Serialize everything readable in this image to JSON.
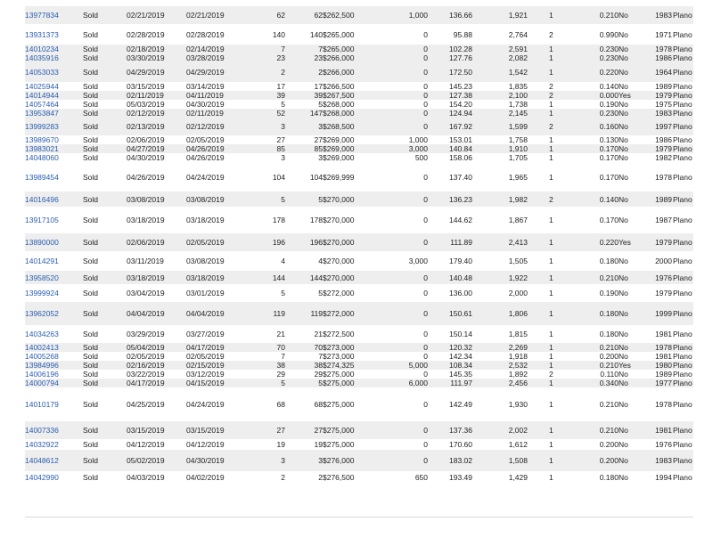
{
  "listings": [
    {
      "mls": "13977834",
      "status": "Sold",
      "sold_date": "02/21/2019",
      "list_date": "02/21/2019",
      "dom": "62",
      "cdom": "62",
      "price": "$262,500",
      "concessions": "1,000",
      "price_per_sqft": "136.66",
      "sqft": "1,921",
      "beds": "1",
      "acres": "0.210",
      "pool": "No",
      "year_built": "1983",
      "city": "Plano"
    },
    {
      "mls": "13931373",
      "status": "Sold",
      "sold_date": "02/28/2019",
      "list_date": "02/28/2019",
      "dom": "140",
      "cdom": "140",
      "price": "$265,000",
      "concessions": "0",
      "price_per_sqft": "95.88",
      "sqft": "2,764",
      "beds": "2",
      "acres": "0.990",
      "pool": "No",
      "year_built": "1971",
      "city": "Plano"
    },
    {
      "mls": "14010234",
      "status": "Sold",
      "sold_date": "02/18/2019",
      "list_date": "02/14/2019",
      "dom": "7",
      "cdom": "7",
      "price": "$265,000",
      "concessions": "0",
      "price_per_sqft": "102.28",
      "sqft": "2,591",
      "beds": "1",
      "acres": "0.230",
      "pool": "No",
      "year_built": "1978",
      "city": "Plano"
    },
    {
      "mls": "14035916",
      "status": "Sold",
      "sold_date": "03/30/2019",
      "list_date": "03/28/2019",
      "dom": "23",
      "cdom": "23",
      "price": "$266,000",
      "concessions": "0",
      "price_per_sqft": "127.76",
      "sqft": "2,082",
      "beds": "1",
      "acres": "0.230",
      "pool": "No",
      "year_built": "1986",
      "city": "Plano"
    },
    {
      "mls": "14053033",
      "status": "Sold",
      "sold_date": "04/29/2019",
      "list_date": "04/29/2019",
      "dom": "2",
      "cdom": "2",
      "price": "$266,000",
      "concessions": "0",
      "price_per_sqft": "172.50",
      "sqft": "1,542",
      "beds": "1",
      "acres": "0.220",
      "pool": "No",
      "year_built": "1964",
      "city": "Plano"
    },
    {
      "mls": "14025944",
      "status": "Sold",
      "sold_date": "03/15/2019",
      "list_date": "03/14/2019",
      "dom": "17",
      "cdom": "17",
      "price": "$266,500",
      "concessions": "0",
      "price_per_sqft": "145.23",
      "sqft": "1,835",
      "beds": "2",
      "acres": "0.140",
      "pool": "No",
      "year_built": "1989",
      "city": "Plano"
    },
    {
      "mls": "14014944",
      "status": "Sold",
      "sold_date": "02/11/2019",
      "list_date": "04/11/2019",
      "dom": "39",
      "cdom": "39",
      "price": "$267,500",
      "concessions": "0",
      "price_per_sqft": "127.38",
      "sqft": "2,100",
      "beds": "2",
      "acres": "0.000",
      "pool": "Yes",
      "year_built": "1979",
      "city": "Plano"
    },
    {
      "mls": "14057464",
      "status": "Sold",
      "sold_date": "05/03/2019",
      "list_date": "04/30/2019",
      "dom": "5",
      "cdom": "5",
      "price": "$268,000",
      "concessions": "0",
      "price_per_sqft": "154.20",
      "sqft": "1,738",
      "beds": "1",
      "acres": "0.190",
      "pool": "No",
      "year_built": "1975",
      "city": "Plano"
    },
    {
      "mls": "13953847",
      "status": "Sold",
      "sold_date": "02/12/2019",
      "list_date": "02/11/2019",
      "dom": "52",
      "cdom": "147",
      "price": "$268,000",
      "concessions": "0",
      "price_per_sqft": "124.94",
      "sqft": "2,145",
      "beds": "1",
      "acres": "0.230",
      "pool": "No",
      "year_built": "1983",
      "city": "Plano"
    },
    {
      "mls": "13999283",
      "status": "Sold",
      "sold_date": "02/13/2019",
      "list_date": "02/12/2019",
      "dom": "3",
      "cdom": "3",
      "price": "$268,500",
      "concessions": "0",
      "price_per_sqft": "167.92",
      "sqft": "1,599",
      "beds": "2",
      "acres": "0.160",
      "pool": "No",
      "year_built": "1997",
      "city": "Plano"
    },
    {
      "mls": "13989670",
      "status": "Sold",
      "sold_date": "02/06/2019",
      "list_date": "02/05/2019",
      "dom": "27",
      "cdom": "27",
      "price": "$269,000",
      "concessions": "1,000",
      "price_per_sqft": "153.01",
      "sqft": "1,758",
      "beds": "1",
      "acres": "0.130",
      "pool": "No",
      "year_built": "1986",
      "city": "Plano"
    },
    {
      "mls": "13983021",
      "status": "Sold",
      "sold_date": "04/27/2019",
      "list_date": "04/26/2019",
      "dom": "85",
      "cdom": "85",
      "price": "$269,000",
      "concessions": "3,000",
      "price_per_sqft": "140.84",
      "sqft": "1,910",
      "beds": "1",
      "acres": "0.170",
      "pool": "No",
      "year_built": "1979",
      "city": "Plano"
    },
    {
      "mls": "14048060",
      "status": "Sold",
      "sold_date": "04/30/2019",
      "list_date": "04/26/2019",
      "dom": "3",
      "cdom": "3",
      "price": "$269,000",
      "concessions": "500",
      "price_per_sqft": "158.06",
      "sqft": "1,705",
      "beds": "1",
      "acres": "0.170",
      "pool": "No",
      "year_built": "1982",
      "city": "Plano"
    },
    {
      "mls": "13989454",
      "status": "Sold",
      "sold_date": "04/26/2019",
      "list_date": "04/24/2019",
      "dom": "104",
      "cdom": "104",
      "price": "$269,999",
      "concessions": "0",
      "price_per_sqft": "137.40",
      "sqft": "1,965",
      "beds": "1",
      "acres": "0.170",
      "pool": "No",
      "year_built": "1978",
      "city": "Plano"
    },
    {
      "mls": "14016496",
      "status": "Sold",
      "sold_date": "03/08/2019",
      "list_date": "03/08/2019",
      "dom": "5",
      "cdom": "5",
      "price": "$270,000",
      "concessions": "0",
      "price_per_sqft": "136.23",
      "sqft": "1,982",
      "beds": "2",
      "acres": "0.140",
      "pool": "No",
      "year_built": "1989",
      "city": "Plano"
    },
    {
      "mls": "13917105",
      "status": "Sold",
      "sold_date": "03/18/2019",
      "list_date": "03/18/2019",
      "dom": "178",
      "cdom": "178",
      "price": "$270,000",
      "concessions": "0",
      "price_per_sqft": "144.62",
      "sqft": "1,867",
      "beds": "1",
      "acres": "0.170",
      "pool": "No",
      "year_built": "1987",
      "city": "Plano"
    },
    {
      "mls": "13890000",
      "status": "Sold",
      "sold_date": "02/06/2019",
      "list_date": "02/05/2019",
      "dom": "196",
      "cdom": "196",
      "price": "$270,000",
      "concessions": "0",
      "price_per_sqft": "111.89",
      "sqft": "2,413",
      "beds": "1",
      "acres": "0.220",
      "pool": "Yes",
      "year_built": "1979",
      "city": "Plano"
    },
    {
      "mls": "14014291",
      "status": "Sold",
      "sold_date": "03/11/2019",
      "list_date": "03/08/2019",
      "dom": "4",
      "cdom": "4",
      "price": "$270,000",
      "concessions": "3,000",
      "price_per_sqft": "179.40",
      "sqft": "1,505",
      "beds": "1",
      "acres": "0.180",
      "pool": "No",
      "year_built": "2000",
      "city": "Plano"
    },
    {
      "mls": "13958520",
      "status": "Sold",
      "sold_date": "03/18/2019",
      "list_date": "03/18/2019",
      "dom": "144",
      "cdom": "144",
      "price": "$270,000",
      "concessions": "0",
      "price_per_sqft": "140.48",
      "sqft": "1,922",
      "beds": "1",
      "acres": "0.210",
      "pool": "No",
      "year_built": "1976",
      "city": "Plano"
    },
    {
      "mls": "13999924",
      "status": "Sold",
      "sold_date": "03/04/2019",
      "list_date": "03/01/2019",
      "dom": "5",
      "cdom": "5",
      "price": "$272,000",
      "concessions": "0",
      "price_per_sqft": "136.00",
      "sqft": "2,000",
      "beds": "1",
      "acres": "0.190",
      "pool": "No",
      "year_built": "1979",
      "city": "Plano"
    },
    {
      "mls": "13962052",
      "status": "Sold",
      "sold_date": "04/04/2019",
      "list_date": "04/04/2019",
      "dom": "119",
      "cdom": "119",
      "price": "$272,000",
      "concessions": "0",
      "price_per_sqft": "150.61",
      "sqft": "1,806",
      "beds": "1",
      "acres": "0.180",
      "pool": "No",
      "year_built": "1999",
      "city": "Plano"
    },
    {
      "mls": "14034263",
      "status": "Sold",
      "sold_date": "03/29/2019",
      "list_date": "03/27/2019",
      "dom": "21",
      "cdom": "21",
      "price": "$272,500",
      "concessions": "0",
      "price_per_sqft": "150.14",
      "sqft": "1,815",
      "beds": "1",
      "acres": "0.180",
      "pool": "No",
      "year_built": "1981",
      "city": "Plano"
    },
    {
      "mls": "14002413",
      "status": "Sold",
      "sold_date": "05/04/2019",
      "list_date": "04/17/2019",
      "dom": "70",
      "cdom": "70",
      "price": "$273,000",
      "concessions": "0",
      "price_per_sqft": "120.32",
      "sqft": "2,269",
      "beds": "1",
      "acres": "0.210",
      "pool": "No",
      "year_built": "1978",
      "city": "Plano"
    },
    {
      "mls": "14005268",
      "status": "Sold",
      "sold_date": "02/05/2019",
      "list_date": "02/05/2019",
      "dom": "7",
      "cdom": "7",
      "price": "$273,000",
      "concessions": "0",
      "price_per_sqft": "142.34",
      "sqft": "1,918",
      "beds": "1",
      "acres": "0.200",
      "pool": "No",
      "year_built": "1981",
      "city": "Plano"
    },
    {
      "mls": "13984996",
      "status": "Sold",
      "sold_date": "02/16/2019",
      "list_date": "02/15/2019",
      "dom": "38",
      "cdom": "38",
      "price": "$274,325",
      "concessions": "5,000",
      "price_per_sqft": "108.34",
      "sqft": "2,532",
      "beds": "1",
      "acres": "0.210",
      "pool": "Yes",
      "year_built": "1980",
      "city": "Plano"
    },
    {
      "mls": "14006196",
      "status": "Sold",
      "sold_date": "03/22/2019",
      "list_date": "03/12/2019",
      "dom": "29",
      "cdom": "29",
      "price": "$275,000",
      "concessions": "0",
      "price_per_sqft": "145.35",
      "sqft": "1,892",
      "beds": "2",
      "acres": "0.110",
      "pool": "No",
      "year_built": "1989",
      "city": "Plano"
    },
    {
      "mls": "14000794",
      "status": "Sold",
      "sold_date": "04/17/2019",
      "list_date": "04/15/2019",
      "dom": "5",
      "cdom": "5",
      "price": "$275,000",
      "concessions": "6,000",
      "price_per_sqft": "111.97",
      "sqft": "2,456",
      "beds": "1",
      "acres": "0.340",
      "pool": "No",
      "year_built": "1977",
      "city": "Plano"
    },
    {
      "mls": "14010179",
      "status": "Sold",
      "sold_date": "04/25/2019",
      "list_date": "04/24/2019",
      "dom": "68",
      "cdom": "68",
      "price": "$275,000",
      "concessions": "0",
      "price_per_sqft": "142.49",
      "sqft": "1,930",
      "beds": "1",
      "acres": "0.210",
      "pool": "No",
      "year_built": "1978",
      "city": "Plano"
    },
    {
      "mls": "14007336",
      "status": "Sold",
      "sold_date": "03/15/2019",
      "list_date": "03/15/2019",
      "dom": "27",
      "cdom": "27",
      "price": "$275,000",
      "concessions": "0",
      "price_per_sqft": "137.36",
      "sqft": "2,002",
      "beds": "1",
      "acres": "0.210",
      "pool": "No",
      "year_built": "1981",
      "city": "Plano"
    },
    {
      "mls": "14032922",
      "status": "Sold",
      "sold_date": "04/12/2019",
      "list_date": "04/12/2019",
      "dom": "19",
      "cdom": "19",
      "price": "$275,000",
      "concessions": "0",
      "price_per_sqft": "170.60",
      "sqft": "1,612",
      "beds": "1",
      "acres": "0.200",
      "pool": "No",
      "year_built": "1976",
      "city": "Plano"
    },
    {
      "mls": "14048612",
      "status": "Sold",
      "sold_date": "05/02/2019",
      "list_date": "04/30/2019",
      "dom": "3",
      "cdom": "3",
      "price": "$276,000",
      "concessions": "0",
      "price_per_sqft": "183.02",
      "sqft": "1,508",
      "beds": "1",
      "acres": "0.200",
      "pool": "No",
      "year_built": "1983",
      "city": "Plano"
    },
    {
      "mls": "14042990",
      "status": "Sold",
      "sold_date": "04/03/2019",
      "list_date": "04/02/2019",
      "dom": "2",
      "cdom": "2",
      "price": "$276,500",
      "concessions": "650",
      "price_per_sqft": "193.49",
      "sqft": "1,429",
      "beds": "1",
      "acres": "0.180",
      "pool": "No",
      "year_built": "1994",
      "city": "Plano"
    }
  ]
}
